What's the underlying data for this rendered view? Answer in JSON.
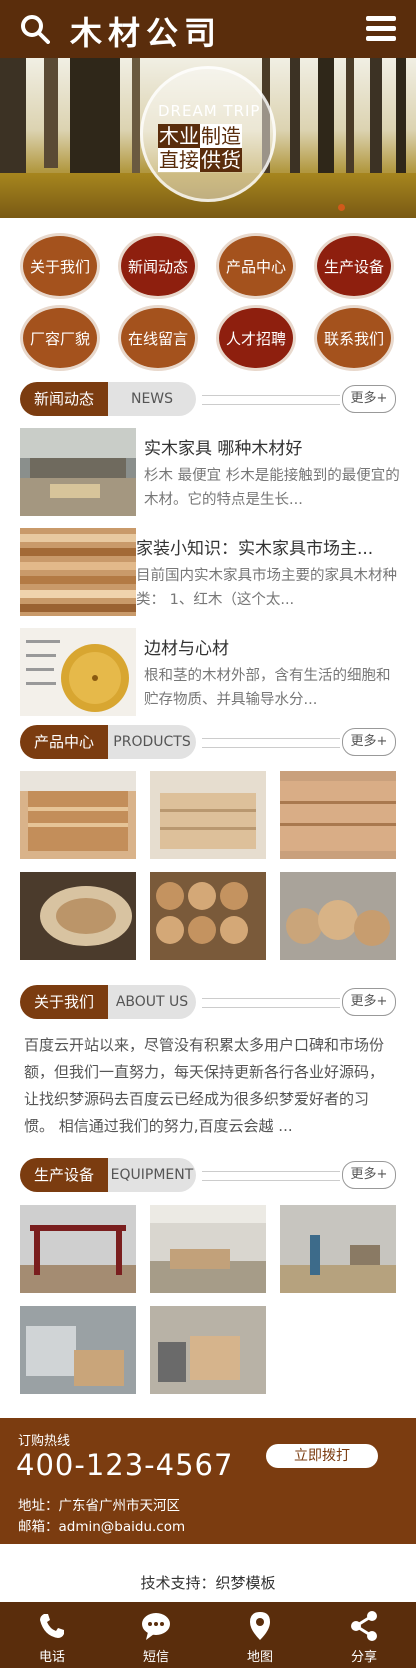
{
  "header": {
    "logo": "木材公司"
  },
  "banner": {
    "en": "DREAM TRIP",
    "cn1a": "木业",
    "cn1b": "制造",
    "cn2a": "直接",
    "cn2b": "供货"
  },
  "nav": [
    {
      "label": "关于我们",
      "color": "orange"
    },
    {
      "label": "新闻动态",
      "color": "red"
    },
    {
      "label": "产品中心",
      "color": "orange"
    },
    {
      "label": "生产设备",
      "color": "red"
    },
    {
      "label": "厂容厂貌",
      "color": "orange"
    },
    {
      "label": "在线留言",
      "color": "orange"
    },
    {
      "label": "人才招聘",
      "color": "red"
    },
    {
      "label": "联系我们",
      "color": "orange"
    }
  ],
  "sections": {
    "news": {
      "cn": "新闻动态",
      "en": "NEWS",
      "more": "更多+"
    },
    "products": {
      "cn": "产品中心",
      "en": "PRODUCTS",
      "more": "更多+"
    },
    "about": {
      "cn": "关于我们",
      "en": "ABOUT US",
      "more": "更多+"
    },
    "equipment": {
      "cn": "生产设备",
      "en": "EQUIPMENT",
      "more": "更多+"
    }
  },
  "news": [
    {
      "title": "实木家具 哪种木材好",
      "desc": "杉木 最便宜 杉木是能接触到的最便宜的木材。它的特点是生长..."
    },
    {
      "title": "家装小知识：实木家具市场主...",
      "desc": "目前国内实木家具市场主要的家具木材种类： 1、红木（这个太..."
    },
    {
      "title": "边材与心材",
      "desc": "根和茎的木材外部，含有生活的细胞和贮存物质、并具输导水分..."
    }
  ],
  "about_text": "百度云开站以来，尽管没有积累太多用户口碑和市场份额，但我们一直努力，每天保持更新各行各业好源码，让找织梦源码去百度云已经成为很多织梦爱好者的习惯。 相信通过我们的努力,百度云会越 ...",
  "contact": {
    "label": "订购热线",
    "tel": "400-123-4567",
    "addr": "地址：广东省广州市天河区",
    "mail": "邮箱：admin@baidu.com",
    "call": "立即拨打"
  },
  "support": "技术支持：织梦模板",
  "bottom": [
    {
      "label": "电话",
      "icon": "phone-icon"
    },
    {
      "label": "短信",
      "icon": "message-icon"
    },
    {
      "label": "地图",
      "icon": "map-pin-icon"
    },
    {
      "label": "分享",
      "icon": "share-icon"
    }
  ],
  "colors": {
    "brand": "#5a2d0c",
    "accent": "#7b3c10",
    "orange": "#a4521d",
    "red": "#8e1f0e"
  }
}
